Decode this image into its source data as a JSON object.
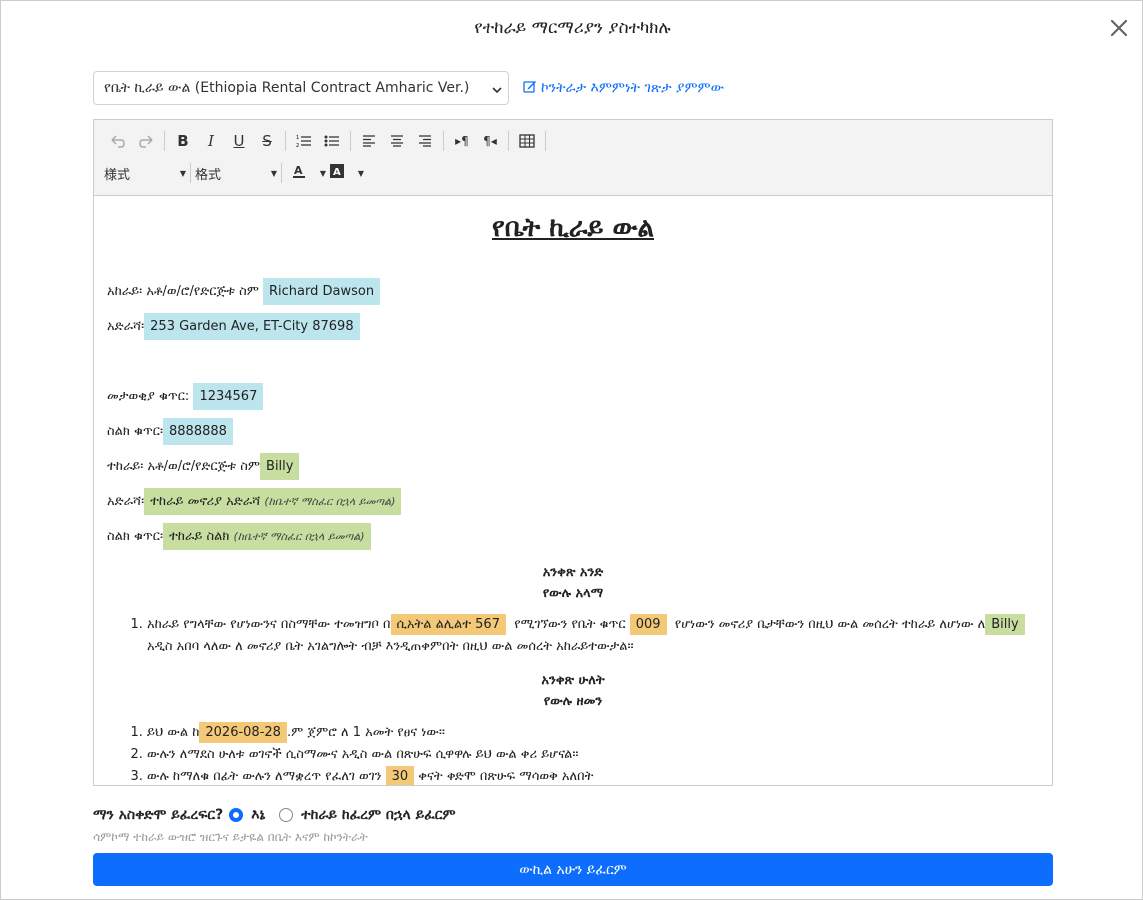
{
  "modal": {
    "title": "የተከራይ ማርማሪያን ያስተካክሉ"
  },
  "template_select": {
    "value": "የቤት ኪራይ ውል (Ethiopia Rental Contract Amharic Ver.)"
  },
  "verify_link": {
    "label": "ኮንትራታ እምምነት ገጽታ ያምምው"
  },
  "toolbar": {
    "style_dropdown": "様式",
    "format_dropdown": "格式"
  },
  "document": {
    "title": "የቤት ኪራይ ውል",
    "landlord_name_label": "አከራይ፡ አቶ/ወ/ሮ/የድርጅቱ ስም",
    "landlord_name": "Richard Dawson",
    "landlord_address_label": "አድራሻ፡",
    "landlord_address": "253 Garden Ave, ET-City 87698",
    "id_label": "መታወቂያ ቁጥር:",
    "id_value": "1234567",
    "phone_label": "ስልክ ቁጥር፡",
    "phone_value": "8888888",
    "tenant_name_label": "ተከራይ፡ አቶ/ወ/ሮ/የድርጅቱ ስም",
    "tenant_name": "Billy",
    "tenant_address_label": "አድራሻ፡",
    "tenant_address": "ተከራይ መኖሪያ አድራሻ",
    "tenant_address_note": "(ከቤተኛ ማስፈር በኋላ ይመጣል)",
    "tenant_phone_label": "ስልክ ቁጥር፡",
    "tenant_phone": "ተከራይ ስልክ",
    "tenant_phone_note": "(ከቤተኛ ማስፈር በኋላ ይመጣል)",
    "article1_title": "አንቀጽ አንድ",
    "article1_sub": "የውሉ አላማ",
    "a1_p1": "አከራይ የግላቸው የሆነውንና በስማቸው ተመዝግቦ በ",
    "a1_cert": "ሲአትል ልሊልተ 567",
    "a1_p2": "የሚገኘውን የቤት ቁጥር",
    "a1_house": "009",
    "a1_p3": "የሆነውን መኖሪያ ቤታቸውን በዚህ ውል መሰረት ተከራይ ለሆነው ለ",
    "a1_tenant": "Billy",
    "a1_p4": "አዲስ አበባ ላለው ለ መኖሪያ ቤት አገልግሎት ብቻ እንዲጠቀምበት በዚህ ውል መሰረት አከራይተውታል።",
    "article2_title": "አንቀጽ ሁለት",
    "article2_sub": "የውሉ ዘመን",
    "a2_i1_p1": "ይህ ውል ከ",
    "a2_date": "2026-08-28",
    "a2_i1_p2": ".ም ጀምሮ ለ 1 አመት የፀና ነው።",
    "a2_i2": "ውሉን ለማደስ ሁለቱ ወገኖች ሲስማሙና አዲስ ውል በጽሁፍ ሲዋዋሉ ይህ ውል ቀሪ ይሆናል።",
    "a2_i3_p1": "ውሉ ከማለቁ በፊት ውሉን ለማቋረጥ የፈለገ ወገን",
    "a2_days": "30",
    "a2_i3_p2": "ቀናት ቀድሞ በጽሁፍ ማሳወቅ አለበት"
  },
  "bottom": {
    "question": "ማን አስቀድሞ ይፈረፍር?",
    "opt_me": "እኔ",
    "opt_tenant": "ተከራይ ከፈረም በኋላ ይፈርም",
    "selected": "እኔ",
    "subtext": "ሳምኮማ ተከራይ ውዝሮ ዝርጉና ይታዬል በቤት እናም ከኮንትራት",
    "button": "ውኪል አሁን ይፈርም"
  }
}
